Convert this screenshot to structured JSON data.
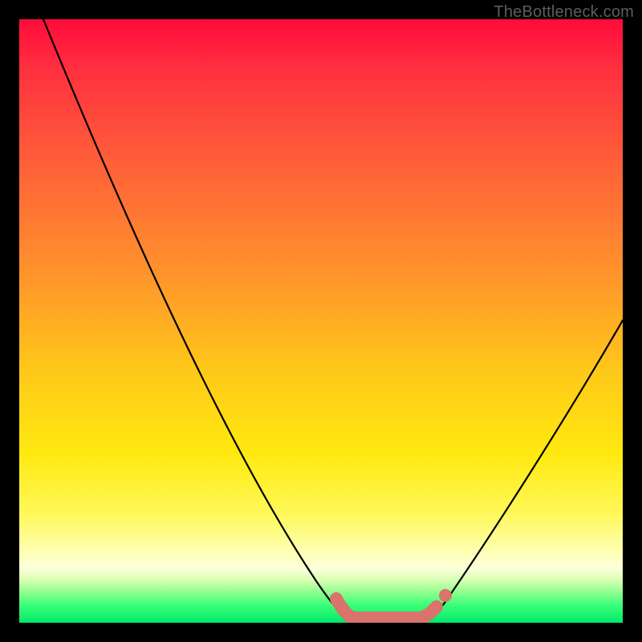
{
  "watermark": "TheBottleneck.com",
  "chart_data": {
    "type": "line",
    "title": "",
    "xlabel": "",
    "ylabel": "",
    "xlim": [
      0,
      100
    ],
    "ylim": [
      0,
      100
    ],
    "series": [
      {
        "name": "bottleneck-curve",
        "x": [
          0,
          5,
          10,
          15,
          20,
          25,
          30,
          35,
          40,
          45,
          50,
          53,
          55,
          57,
          60,
          63,
          65,
          67,
          70,
          75,
          80,
          85,
          90,
          95,
          100
        ],
        "values": [
          100,
          90,
          80,
          70,
          61,
          52,
          43,
          34,
          26,
          18,
          11,
          7,
          3,
          1,
          0,
          0,
          0,
          1,
          3,
          8,
          15,
          23,
          32,
          41,
          50
        ]
      }
    ],
    "highlight": {
      "x_range": [
        53,
        67
      ],
      "note": "optimal-zone"
    },
    "background_gradient": {
      "stops": [
        {
          "pos": 0,
          "color": "#ff0b3a"
        },
        {
          "pos": 8,
          "color": "#ff2f3f"
        },
        {
          "pos": 22,
          "color": "#ff5a3a"
        },
        {
          "pos": 40,
          "color": "#ff8d2e"
        },
        {
          "pos": 58,
          "color": "#ffc71a"
        },
        {
          "pos": 72,
          "color": "#ffe90f"
        },
        {
          "pos": 82,
          "color": "#fff85a"
        },
        {
          "pos": 88,
          "color": "#ffffb0"
        },
        {
          "pos": 91,
          "color": "#fdffda"
        },
        {
          "pos": 93,
          "color": "#d6ffb3"
        },
        {
          "pos": 95,
          "color": "#8cff8e"
        },
        {
          "pos": 97,
          "color": "#3dff7a"
        },
        {
          "pos": 100,
          "color": "#00e86a"
        }
      ]
    }
  }
}
